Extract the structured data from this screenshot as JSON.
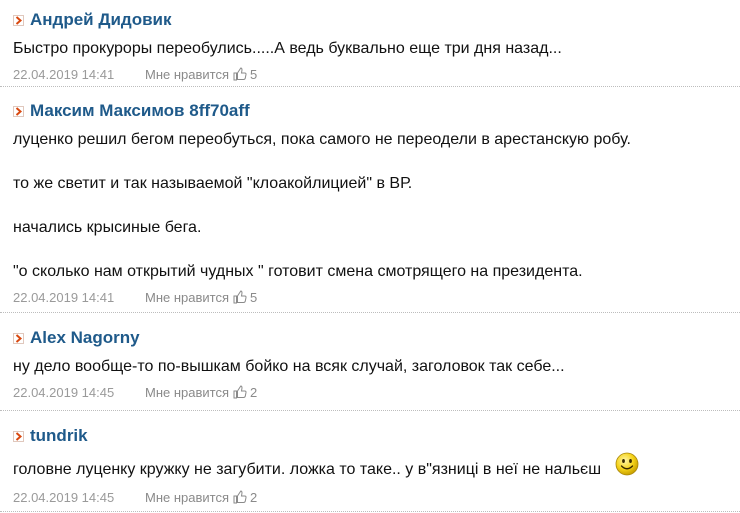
{
  "colors": {
    "author": "#1f5a8a",
    "arrow": "#d9480f",
    "meta": "#9a9a9a"
  },
  "icons": {
    "arrow": "arrow-right-icon",
    "like": "thumbs-up-icon",
    "emoji": "smiley-icon"
  },
  "comments": [
    {
      "author": "Андрей Дидовик",
      "text": [
        "Быстро прокуроры переобулись.....А ведь буквально еще три дня назад..."
      ],
      "date": "22.04.2019 14:41",
      "like_label": "Мне нравится",
      "likes": "5"
    },
    {
      "author": "Максим Максимов 8ff70aff",
      "text": [
        "луценко решил бегом переобуться, пока самого не переодели в арестанскую робу.",
        "то же светит и так называемой \"клоакойлицией\" в ВР.",
        "начались крысиные бега.",
        "\"о сколько нам открытий чудных \" готовит смена смотрящего на президента."
      ],
      "date": "22.04.2019 14:41",
      "like_label": "Мне нравится",
      "likes": "5"
    },
    {
      "author": "Alex Nagorny",
      "text": [
        "ну дело вообще-то по-вышкам бойко на всяк случай, заголовок так себе..."
      ],
      "date": "22.04.2019 14:45",
      "like_label": "Мне нравится",
      "likes": "2"
    },
    {
      "author": "tundrik",
      "text": [
        "головне луценку кружку не загубити. ложка то таке.. у в\"язниці в неї не нальєш"
      ],
      "date": "22.04.2019 14:45",
      "like_label": "Мне нравится",
      "likes": "2"
    }
  ]
}
